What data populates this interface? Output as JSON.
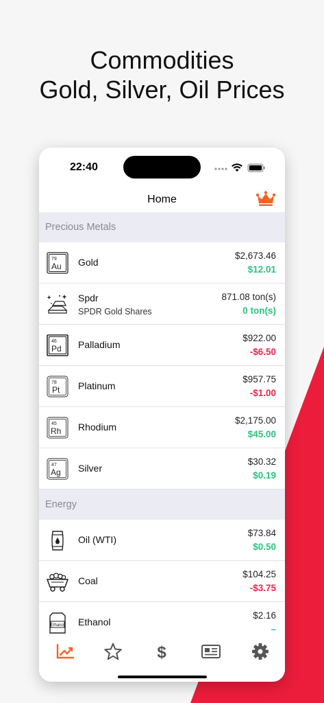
{
  "headline": {
    "line1": "Commodities",
    "line2": "Gold, Silver, Oil Prices"
  },
  "status_bar": {
    "time": "22:40",
    "icons": [
      "signal-dots-icon",
      "wifi-icon",
      "battery-icon"
    ]
  },
  "nav": {
    "title": "Home",
    "premium_icon": "crown-icon"
  },
  "colors": {
    "accent": "#f26322",
    "positive": "#2ec27e",
    "negative": "#e8264a",
    "section_bg": "#ebebf3",
    "brand_red": "#ec1d3b"
  },
  "sections": [
    {
      "title": "Precious Metals",
      "items": [
        {
          "icon": "element-tile-icon",
          "atomic_number": "79",
          "symbol": "Au",
          "name": "Gold",
          "price": "$2,673.46",
          "change": "$12.01",
          "direction": "up"
        },
        {
          "icon": "gold-bars-icon",
          "name": "Spdr",
          "subtitle": "SPDR Gold Shares",
          "price": "871.08 ton(s)",
          "change": "0 ton(s)",
          "direction": "up"
        },
        {
          "icon": "element-tile-icon",
          "atomic_number": "46",
          "symbol": "Pd",
          "name": "Palladium",
          "price": "$922.00",
          "change": "-$6.50",
          "direction": "down"
        },
        {
          "icon": "element-tile-icon",
          "atomic_number": "78",
          "symbol": "Pt",
          "name": "Platinum",
          "price": "$957.75",
          "change": "-$1.00",
          "direction": "down"
        },
        {
          "icon": "element-tile-icon",
          "atomic_number": "45",
          "symbol": "Rh",
          "name": "Rhodium",
          "price": "$2,175.00",
          "change": "$45.00",
          "direction": "up"
        },
        {
          "icon": "element-tile-icon",
          "atomic_number": "47",
          "symbol": "Ag",
          "name": "Silver",
          "price": "$30.32",
          "change": "$0.19",
          "direction": "up"
        }
      ]
    },
    {
      "title": "Energy",
      "items": [
        {
          "icon": "oil-barrel-icon",
          "name": "Oil (WTI)",
          "price": "$73.84",
          "change": "$0.50",
          "direction": "up"
        },
        {
          "icon": "coal-cart-icon",
          "name": "Coal",
          "price": "$104.25",
          "change": "-$3.75",
          "direction": "down"
        },
        {
          "icon": "ethanol-canister-icon",
          "icon_text": "Ethanol",
          "name": "Ethanol",
          "price": "$2.16",
          "change": "–",
          "direction": "up"
        }
      ]
    }
  ],
  "tabs": [
    {
      "icon": "chart-icon",
      "active": true
    },
    {
      "icon": "star-icon",
      "active": false
    },
    {
      "icon": "dollar-icon",
      "active": false
    },
    {
      "icon": "news-icon",
      "active": false
    },
    {
      "icon": "gear-icon",
      "active": false
    }
  ]
}
